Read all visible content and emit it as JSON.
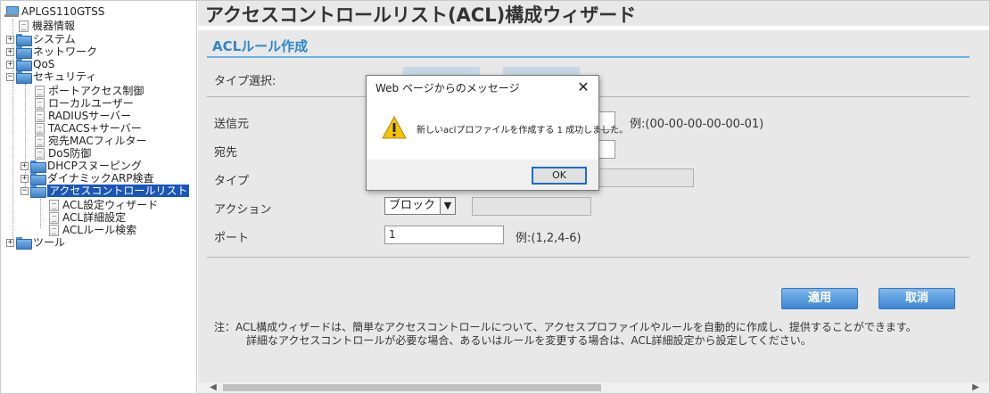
{
  "tree": {
    "root": "APLGS110GTSS",
    "items": [
      {
        "label": "機器情報",
        "type": "doc"
      },
      {
        "label": "システム",
        "type": "folder",
        "toggle": "+"
      },
      {
        "label": "ネットワーク",
        "type": "folder",
        "toggle": "+"
      },
      {
        "label": "QoS",
        "type": "folder",
        "toggle": "+"
      },
      {
        "label": "セキュリティ",
        "type": "folder",
        "toggle": "−"
      }
    ],
    "security": [
      "ポートアクセス制御",
      "ローカルユーザー",
      "RADIUSサーバー",
      "TACACS+サーバー",
      "宛先MACフィルター",
      "DoS防御"
    ],
    "dhcp": "DHCPスヌーピング",
    "arp": "ダイナミックARP検査",
    "acl": "アクセスコントロールリスト",
    "acl_children": [
      "ACL設定ウィザード",
      "ACL詳細設定",
      "ACLルール検索"
    ],
    "tools": "ツール"
  },
  "main": {
    "title": "アクセスコントロールリスト(ACL)構成ウィザード",
    "section": "ACLルール作成",
    "type_select_label": "タイプ選択:",
    "fields": {
      "source_label": "送信元",
      "source_example": "例:(00-00-00-00-00-01)",
      "dest_label": "宛先",
      "type_label": "タイプ",
      "action_label": "アクション",
      "action_value": "ブロック",
      "port_label": "ポート",
      "port_value": "1",
      "port_example": "例:(1,2,4-6)"
    },
    "apply_label": "適用",
    "cancel_label": "取消",
    "note_line1": "注：ACL構成ウィザードは、簡単なアクセスコントロールについて、アクセスプロファイルやルールを自動的に作成し、提供することができます。",
    "note_line2": "詳細なアクセスコントロールが必要な場合、あるいはルールを変更する場合は、ACL詳細設定から設定してください。"
  },
  "dialog": {
    "title": "Web ページからのメッセージ",
    "message": "新しいaclプロファイルを作成する 1 成功しました。",
    "ok_label": "OK"
  },
  "colors": {
    "accent": "#2e86c8",
    "selection": "#1a56b8",
    "button": "#3f86d1"
  }
}
